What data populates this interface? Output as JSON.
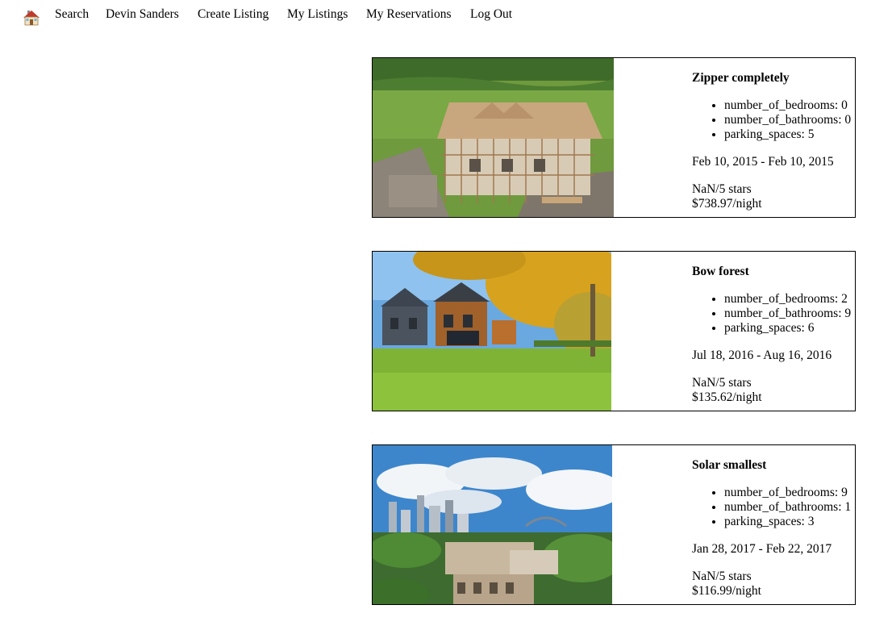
{
  "nav": {
    "home_icon": "house-emoji-icon",
    "items": [
      {
        "label": "Search"
      },
      {
        "label": "Devin Sanders"
      },
      {
        "label": "Create Listing"
      },
      {
        "label": "My Listings"
      },
      {
        "label": "My Reservations"
      },
      {
        "label": "Log Out"
      }
    ]
  },
  "listings": [
    {
      "title": "Zipper completely",
      "photo": "house-under-construction-photo",
      "features": [
        "number_of_bedrooms: 0",
        "number_of_bathrooms: 0",
        "parking_spaces: 5"
      ],
      "dates": "Feb 10, 2015 - Feb 10, 2015",
      "rating": "NaN/5 stars",
      "price": "$738.97/night"
    },
    {
      "title": "Bow forest",
      "photo": "modern-barn-houses-photo",
      "features": [
        "number_of_bedrooms: 2",
        "number_of_bathrooms: 9",
        "parking_spaces: 6"
      ],
      "dates": "Jul 18, 2016 - Aug 16, 2016",
      "rating": "NaN/5 stars",
      "price": "$135.62/night"
    },
    {
      "title": "Solar smallest",
      "photo": "city-skyline-photo",
      "features": [
        "number_of_bedrooms: 9",
        "number_of_bathrooms: 1",
        "parking_spaces: 3"
      ],
      "dates": "Jan 28, 2017 - Feb 22, 2017",
      "rating": "NaN/5 stars",
      "price": "$116.99/night"
    }
  ]
}
